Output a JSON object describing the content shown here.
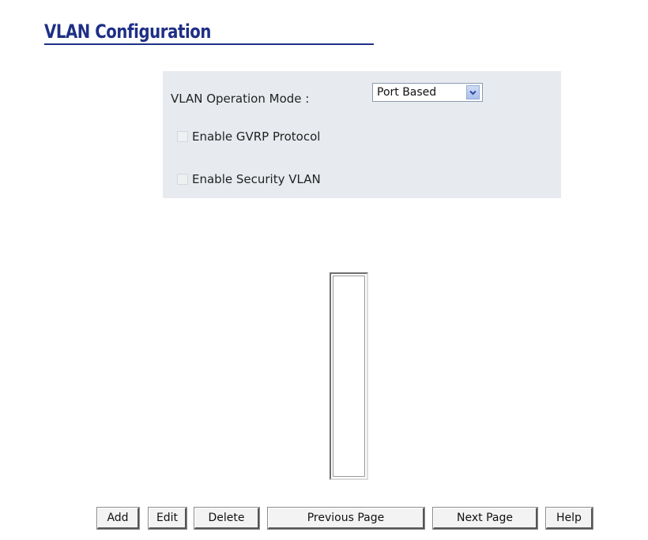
{
  "header": {
    "title": "VLAN Configuration"
  },
  "settings": {
    "mode_label": "VLAN Operation Mode :",
    "mode_select": {
      "value": "Port Based",
      "arrow_icon": "chevron-down-icon"
    },
    "gvrp": {
      "label": "Enable GVRP Protocol",
      "checked": false
    },
    "security_vlan": {
      "label": "Enable Security VLAN",
      "checked": false
    }
  },
  "vlan_list": {
    "items": []
  },
  "buttons": {
    "add": "Add",
    "edit": "Edit",
    "delete": "Delete",
    "previous_page": "Previous Page",
    "next_page": "Next Page",
    "help": "Help"
  },
  "colors": {
    "title": "#1f2f86",
    "panel_background": "#e7ebef"
  }
}
